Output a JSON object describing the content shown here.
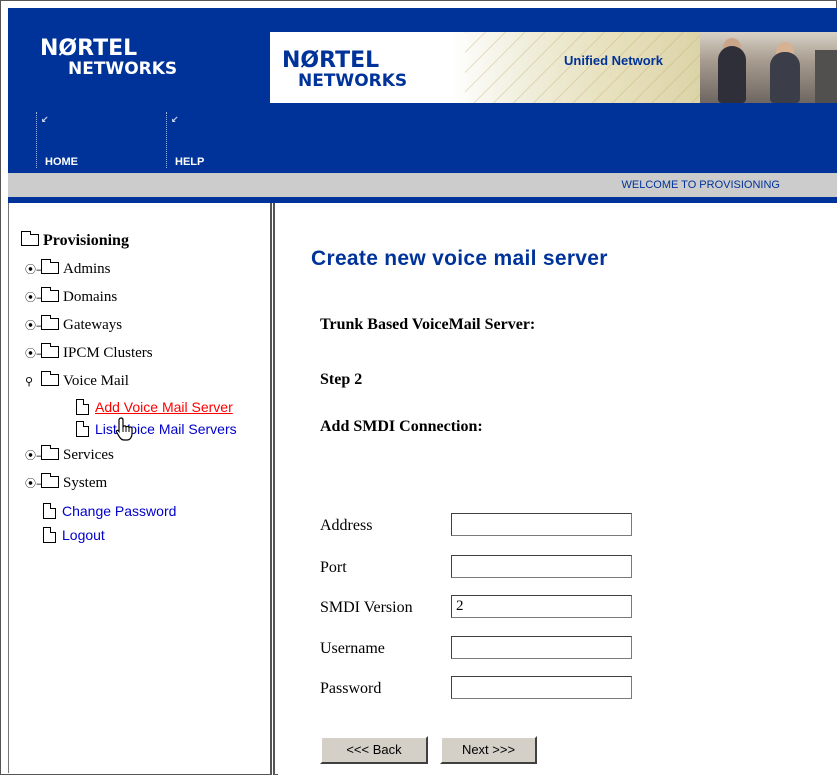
{
  "header": {
    "logo_line1": "NØRTEL",
    "logo_line2": "NETWORKS",
    "banner_logo_line1": "NØRTEL",
    "banner_logo_line2": "NETWORKS",
    "banner_tagline": "Unified Network",
    "nav": [
      {
        "label": "HOME",
        "icon": "broken-image-icon"
      },
      {
        "label": "HELP",
        "icon": "broken-image-icon"
      }
    ]
  },
  "welcome": "WELCOME TO PROVISIONING",
  "tree": {
    "root": "Provisioning",
    "items": [
      {
        "label": "Admins"
      },
      {
        "label": "Domains"
      },
      {
        "label": "Gateways"
      },
      {
        "label": "IPCM Clusters"
      },
      {
        "label": "Voice Mail"
      },
      {
        "label": "Services"
      },
      {
        "label": "System"
      }
    ],
    "voicemail_children": [
      "Add Voice Mail Server",
      "List Voice Mail Servers"
    ],
    "links": [
      "Change Password",
      "Logout"
    ]
  },
  "main": {
    "title": "Create new voice mail server",
    "subtitle": "Trunk Based VoiceMail Server:",
    "step": "Step 2",
    "section": "Add SMDI Connection:",
    "fields": [
      {
        "label": "Address",
        "value": ""
      },
      {
        "label": "Port",
        "value": ""
      },
      {
        "label": "SMDI Version",
        "value": "2"
      },
      {
        "label": "Username",
        "value": ""
      },
      {
        "label": "Password",
        "value": ""
      }
    ],
    "back_label": "<<< Back",
    "next_label": "Next >>>"
  },
  "colors": {
    "brand_blue": "#00339a",
    "active_link": "#ff0000",
    "link": "#0000cc"
  }
}
